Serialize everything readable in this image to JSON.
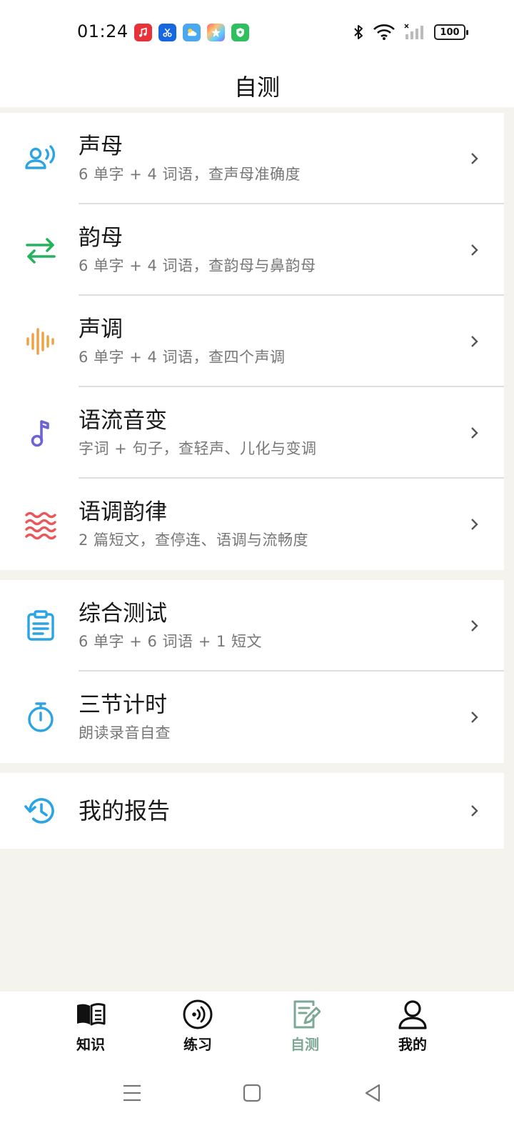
{
  "status_bar": {
    "time": "01:24",
    "battery": "100",
    "app_icons": [
      "music-app-icon",
      "scissors-app-icon",
      "weather-app-icon",
      "photos-app-icon",
      "security-app-icon"
    ]
  },
  "header": {
    "title": "自测"
  },
  "groups": [
    {
      "items": [
        {
          "icon": "voice-icon",
          "title": "声母",
          "subtitle": "6 单字 + 4 词语，查声母准确度"
        },
        {
          "icon": "swap-arrows-icon",
          "title": "韵母",
          "subtitle": "6 单字 + 4 词语，查韵母与鼻韵母"
        },
        {
          "icon": "waveform-icon",
          "title": "声调",
          "subtitle": "6 单字 + 4 词语，查四个声调"
        },
        {
          "icon": "music-note-icon",
          "title": "语流音变",
          "subtitle": "字词 + 句子，查轻声、儿化与变调"
        },
        {
          "icon": "waves-icon",
          "title": "语调韵律",
          "subtitle": "2 篇短文，查停连、语调与流畅度"
        }
      ]
    },
    {
      "items": [
        {
          "icon": "clipboard-icon",
          "title": "综合测试",
          "subtitle": "6 单字 + 6 词语 + 1 短文"
        },
        {
          "icon": "stopwatch-icon",
          "title": "三节计时",
          "subtitle": "朗读录音自查"
        }
      ]
    },
    {
      "items": [
        {
          "icon": "history-icon",
          "title": "我的报告"
        }
      ]
    }
  ],
  "bottom_nav": [
    {
      "icon": "book-icon",
      "label": "知识"
    },
    {
      "icon": "speaker-circle-icon",
      "label": "练习"
    },
    {
      "icon": "edit-doc-icon",
      "label": "自测",
      "active": true
    },
    {
      "icon": "user-icon",
      "label": "我的"
    }
  ],
  "colors": {
    "blue": "#2aa4e3",
    "green": "#22b35c",
    "orange": "#f0a040",
    "purple": "#6b63d6",
    "red": "#e9575a",
    "active_tab": "#7ea896",
    "separator_bg": "#f5f3ee"
  }
}
